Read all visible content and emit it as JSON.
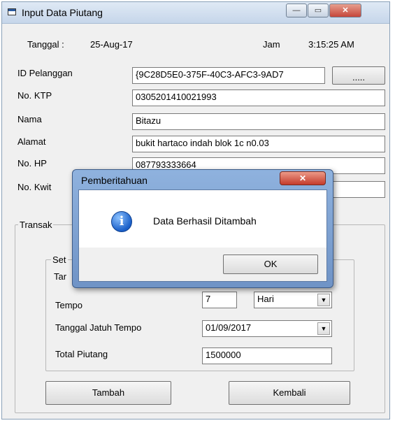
{
  "window": {
    "title": "Input Data Piutang",
    "icon": "form-icon",
    "controls": {
      "minimize": "—",
      "maximize": "▭",
      "close": "✕"
    }
  },
  "header": {
    "date_label": "Tanggal :",
    "date_value": "25-Aug-17",
    "time_label": "Jam",
    "time_value": "3:15:25 AM"
  },
  "form": {
    "id_pelanggan": {
      "label": "ID Pelanggan",
      "value": "{9C28D5E0-375F-40C3-AFC3-9AD7",
      "browse_button": "....."
    },
    "no_ktp": {
      "label": "No. KTP",
      "value": "0305201410021993"
    },
    "nama": {
      "label": "Nama",
      "value": "Bitazu"
    },
    "alamat": {
      "label": "Alamat",
      "value": "bukit hartaco indah blok 1c n0.03"
    },
    "no_hp": {
      "label": "No. HP",
      "value": "087793333664"
    },
    "no_kwitansi": {
      "label": "No. Kwit",
      "value": ""
    }
  },
  "transaksi": {
    "group_title": "Transak",
    "sub_group_title": "Set",
    "tanggal_label_partial": "Tar",
    "tempo": {
      "label": "Tempo",
      "value": "7",
      "unit": "Hari"
    },
    "jatuh_tempo": {
      "label": "Tanggal Jatuh Tempo",
      "value": "01/09/2017"
    },
    "total_piutang": {
      "label": "Total Piutang",
      "value": "1500000"
    }
  },
  "buttons": {
    "tambah": "Tambah",
    "kembali": "Kembali"
  },
  "dialog": {
    "title": "Pemberitahuan",
    "close": "✕",
    "icon": "info-icon",
    "icon_glyph": "i",
    "message": "Data Berhasil Ditambah",
    "ok": "OK"
  }
}
